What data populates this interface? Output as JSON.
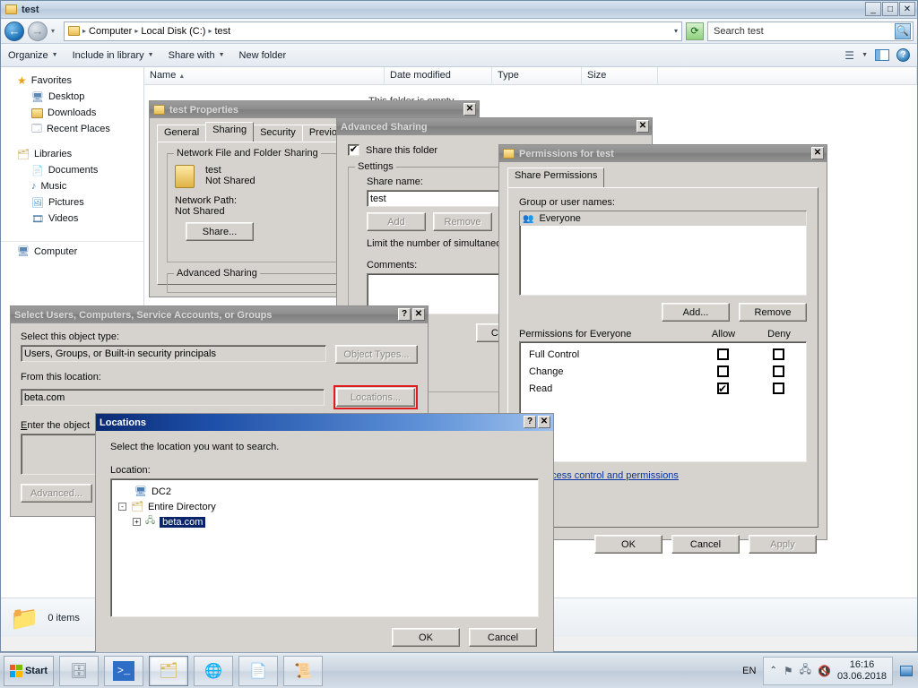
{
  "explorer": {
    "title": "test",
    "window_controls": {
      "minimize": "_",
      "maximize": "□",
      "close": "✕"
    },
    "address": {
      "crumbs": [
        "Computer",
        "Local Disk (C:)",
        "test"
      ],
      "separator": "▾"
    },
    "search": {
      "placeholder": "Search test",
      "value": "Search test"
    },
    "toolbar": {
      "organize": "Organize",
      "include_in_library": "Include in library",
      "share_with": "Share with",
      "new_folder": "New folder"
    },
    "nav": {
      "favorites": "Favorites",
      "favorites_items": [
        "Desktop",
        "Downloads",
        "Recent Places"
      ],
      "libraries": "Libraries",
      "libraries_items": [
        "Documents",
        "Music",
        "Pictures",
        "Videos"
      ],
      "computer": "Computer"
    },
    "columns": [
      "Name",
      "Date modified",
      "Type",
      "Size"
    ],
    "sort_indicator": "▲",
    "empty_message": "This folder is empty.",
    "status": {
      "items": "0 items"
    }
  },
  "properties_dialog": {
    "title": "test Properties",
    "close": "✕",
    "tabs": [
      "General",
      "Sharing",
      "Security",
      "Previous"
    ],
    "active_tab": "Sharing",
    "network_group_label": "Network File and Folder Sharing",
    "folder_name": "test",
    "folder_state": "Not Shared",
    "network_path_label": "Network Path:",
    "network_path_value": "Not Shared",
    "share_button": "Share...",
    "advanced_group_label": "Advanced Sharing"
  },
  "advanced_sharing_dialog": {
    "title": "Advanced Sharing",
    "close": "✕",
    "share_checkbox_label": "Share this folder",
    "share_checkbox_checked": true,
    "settings_label": "Settings",
    "share_name_label": "Share name:",
    "share_name_value": "test",
    "add_button": "Add",
    "remove_button": "Remove",
    "limit_text": "Limit the number of simultaneo",
    "comments_label": "Comments:",
    "caching_button": "Caching"
  },
  "permissions_dialog": {
    "title": "Permissions for test",
    "close": "✕",
    "tab": "Share Permissions",
    "group_list_label": "Group or user names:",
    "entries": [
      "Everyone"
    ],
    "add_button": "Add...",
    "remove_button": "Remove",
    "permissions_label": "Permissions for Everyone",
    "col_allow": "Allow",
    "col_deny": "Deny",
    "rows": [
      {
        "name": "Full Control",
        "allow": false,
        "deny": false
      },
      {
        "name": "Change",
        "allow": false,
        "deny": false
      },
      {
        "name": "Read",
        "allow": true,
        "deny": false
      }
    ],
    "help_link": "bout access control and permissions",
    "ok": "OK",
    "cancel": "Cancel",
    "apply": "Apply"
  },
  "select_users_dialog": {
    "title": "Select Users, Computers, Service Accounts, or Groups",
    "help": "?",
    "close": "✕",
    "object_type_label": "Select this object type:",
    "object_type_value": "Users, Groups, or Built-in security principals",
    "object_types_button": "Object Types...",
    "from_location_label": "From this location:",
    "from_location_value": "beta.com",
    "locations_button": "Locations...",
    "enter_object_label": "Enter the object",
    "advanced_button": "Advanced..."
  },
  "locations_dialog": {
    "title": "Locations",
    "help": "?",
    "close": "✕",
    "prompt": "Select the location you want to search.",
    "location_label": "Location:",
    "tree": [
      {
        "label": "DC2",
        "level": 0,
        "expander": "",
        "selected": false
      },
      {
        "label": "Entire Directory",
        "level": 0,
        "expander": "-",
        "selected": false
      },
      {
        "label": "beta.com",
        "level": 1,
        "expander": "+",
        "selected": true
      }
    ],
    "ok": "OK",
    "cancel": "Cancel"
  },
  "taskbar": {
    "start": "Start",
    "tasks": [
      "server-manager-icon",
      "powershell-icon",
      "explorer-icon",
      "network-icon",
      "notepad-icon",
      "certificates-icon"
    ],
    "language": "EN",
    "tray_icons": [
      "chevron-up-icon",
      "flag-icon",
      "network-icon",
      "volume-muted-icon"
    ],
    "time": "16:16",
    "date": "03.06.2018"
  },
  "highlight_color": "#e01b1b"
}
